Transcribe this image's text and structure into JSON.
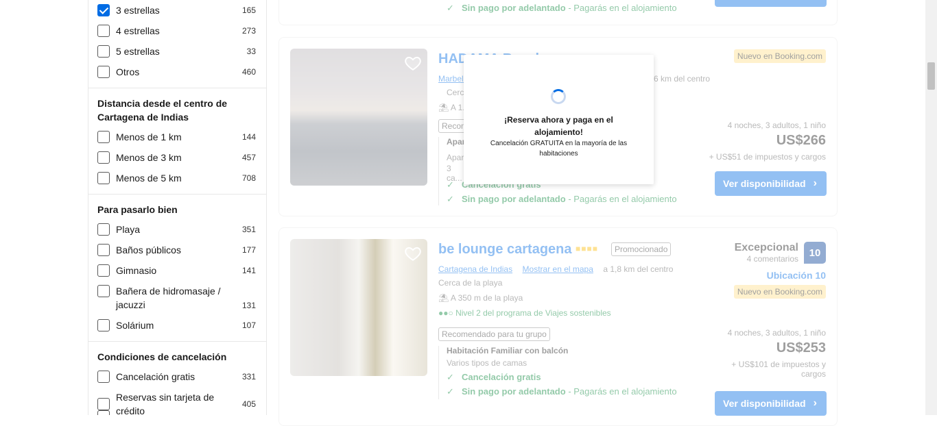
{
  "filters": {
    "stars": [
      {
        "label": "3 estrellas",
        "count": "165",
        "checked": true
      },
      {
        "label": "4 estrellas",
        "count": "273",
        "checked": false
      },
      {
        "label": "5 estrellas",
        "count": "33",
        "checked": false
      },
      {
        "label": "Otros",
        "count": "460",
        "checked": false
      }
    ],
    "distance": {
      "heading": "Distancia desde el centro de Cartagena de Indias",
      "items": [
        {
          "label": "Menos de 1 km",
          "count": "144"
        },
        {
          "label": "Menos de 3 km",
          "count": "457"
        },
        {
          "label": "Menos de 5 km",
          "count": "708"
        }
      ]
    },
    "fun": {
      "heading": "Para pasarlo bien",
      "items": [
        {
          "label": "Playa",
          "count": "351"
        },
        {
          "label": "Baños públicos",
          "count": "177"
        },
        {
          "label": "Gimnasio",
          "count": "141"
        },
        {
          "label": "Bañera de hidromasaje / jacuzzi",
          "count": "131"
        },
        {
          "label": "Solárium",
          "count": "107"
        }
      ]
    },
    "cancellation": {
      "heading": "Condiciones de cancelación",
      "items": [
        {
          "label": "Cancelación gratis",
          "count": "331"
        },
        {
          "label": "Reservas sin tarjeta de crédito",
          "count": "405"
        }
      ]
    }
  },
  "card0": {
    "no_prepay": "Sin pago por adelantado",
    "pay_at_property": "- Pagarás en el alojamiento"
  },
  "card1": {
    "title": "HADAMA Beach...",
    "location": "Marbella",
    "distance": "6 km del centro",
    "near": "Cerca...",
    "beach": "A 1...",
    "badge_new": "Nuevo en Booking.com",
    "recommended": "Recom...",
    "room_name": "Apar...",
    "room_desc": "Apar...",
    "beds": "3 ca...",
    "nights": "4 noches, 3 adultos, 1 niño",
    "price": "US$266",
    "taxes": "+ US$51 de impuestos y cargos",
    "free_cancel": "Cancelación gratis",
    "no_prepay": "Sin pago por adelantado",
    "pay_at_property": "- Pagarás en el alojamiento",
    "button": "Ver disponibilidad"
  },
  "card2": {
    "title": "be lounge cartagena",
    "promoted": "Promocionado",
    "location": "Cartagena de Indias",
    "map_link": "Mostrar en el mapa",
    "distance": "a 1,8 km del centro",
    "near": "Cerca de la playa",
    "beach": "A 350 m de la playa",
    "sustainable": "Nivel 2 del programa de Viajes sostenibles",
    "recommended": "Recomendado para tu grupo",
    "room_name": "Habitación Familiar con balcón",
    "room_desc": "Varios tipos de camas",
    "free_cancel": "Cancelación gratis",
    "no_prepay": "Sin pago por adelantado",
    "pay_at_property": "- Pagarás en el alojamiento",
    "review_word": "Excepcional",
    "review_count": "4 comentarios",
    "score": "10",
    "location_score": "Ubicación 10",
    "badge_new": "Nuevo en Booking.com",
    "nights": "4 noches, 3 adultos, 1 niño",
    "price": "US$253",
    "taxes": "+ US$101 de impuestos y cargos",
    "button": "Ver disponibilidad"
  },
  "modal": {
    "title": "¡Reserva ahora y paga en el alojamiento!",
    "subtitle": "Cancelación GRATUITA en la mayoría de las habitaciones"
  },
  "colors": {
    "accent": "#006ce4",
    "green": "#008234",
    "badge": "#ffe08a"
  }
}
